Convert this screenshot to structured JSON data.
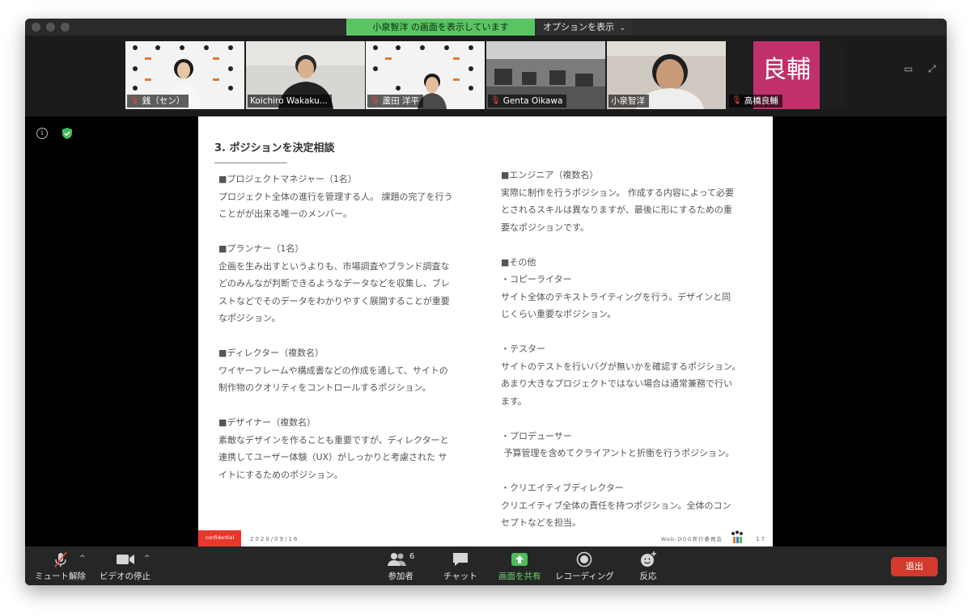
{
  "top_bar": {
    "share_banner": "小泉智洋 の画面を表示しています",
    "options_label": "オプションを表示",
    "options_icon": "chevron-down-icon"
  },
  "participants": [
    {
      "name": "銭（セン）",
      "muted": true,
      "active": false
    },
    {
      "name": "Koichiro Wakaku...",
      "muted": false,
      "active": false
    },
    {
      "name": "蘆田 洋平",
      "muted": true,
      "active": false
    },
    {
      "name": "Genta Oikawa",
      "muted": true,
      "active": false
    },
    {
      "name": "小泉智洋",
      "muted": false,
      "active": true
    },
    {
      "name": "高橋良輔",
      "muted": true,
      "active": false,
      "placeholder_text": "良輔"
    }
  ],
  "slide": {
    "title": "3. ポジションを決定相談",
    "left_column": "■プロジェクトマネジャー（1名）\nプロジェクト全体の進行を管理する人。 課題の完了を行う\nことがが出来る唯一のメンバー。\n\n■プランナー（1名）\n企画を生み出すというよりも、市場調査やブランド調査な\nどのみんなが判断できるようなデータなどを収集し、ブレ\nストなどでそのデータをわかりやすく展開することが重要\nなポジション。\n\n■ディレクター（複数名）\nワイヤーフレームや構成書などの作成を通して、サイトの\n制作物のクオリティをコントロールするポジション。\n\n■デザイナー（複数名）\n素敵なデザインを作ることも重要ですが、ディレクターと\n連携してユーザー体験（UX）がしっかりと考慮された サ\nイトにするためのポジション。",
    "right_column": "■エンジニア（複数名）\n実際に制作を行うポジション。 作成する内容によって必要\nとされるスキルは異なりますが、最後に形にするための重\n要なポジションです。\n\n■その他\n・コピーライター\nサイト全体のテキストライティングを行う。デザインと同\nじくらい重要なポジション。\n\n・テスター\nサイトのテストを行いバグが無いかを確認するポジション。\nあまり大きなプロジェクトではない場合は通常兼務で行い\nます。\n\n・プロデューサー\n 予算管理を含めてクライアントと折衝を行うポジション。\n\n・クリエイティブディレクター\nクリエイティブ全体の責任を持つポジション。全体のコン\nセプトなどを担当。",
    "footer_confidential": "confidential",
    "footer_date": "2020/09/16",
    "footer_org": "Web-DOG実行委員会",
    "footer_page": "17"
  },
  "toolbar": {
    "unmute_label": "ミュート解除",
    "video_label": "ビデオの停止",
    "participants_label": "参加者",
    "participants_count": "6",
    "chat_label": "チャット",
    "share_label": "画面を共有",
    "record_label": "レコーディング",
    "reaction_label": "反応",
    "leave_label": "退出"
  },
  "colors": {
    "share_green": "#5ac463",
    "leave_red": "#d23a2e",
    "active_speaker": "#d6dc3e",
    "confidential_red": "#e8382c",
    "name_tile_pink": "#c0306a"
  }
}
